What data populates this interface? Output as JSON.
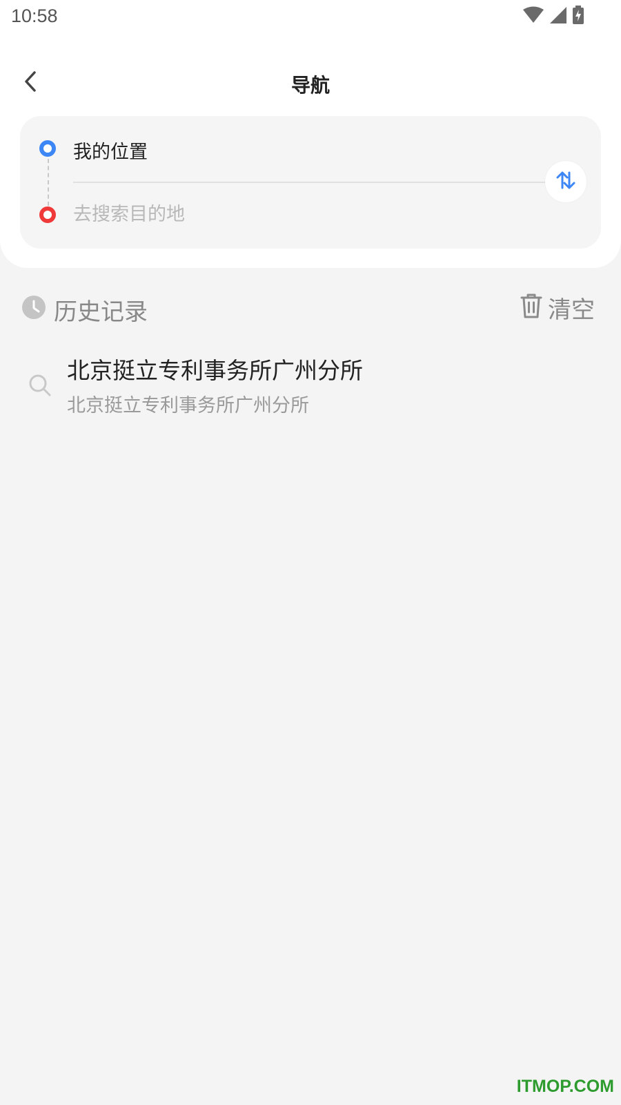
{
  "status_bar": {
    "time": "10:58",
    "icons": [
      "wifi-icon",
      "signal-icon",
      "battery-charging-icon"
    ]
  },
  "header": {
    "back_icon": "chevron-left-icon",
    "title": "导航"
  },
  "route": {
    "origin_label": "我的位置",
    "destination_value": "",
    "destination_placeholder": "去搜索目的地",
    "origin_color": "#3d86f6",
    "destination_color": "#f03a3a",
    "swap_icon": "swap-vertical-icon",
    "accent_color": "#3d86f6"
  },
  "history": {
    "title": "历史记录",
    "title_icon": "clock-icon",
    "clear_label": "清空",
    "clear_icon": "trash-icon",
    "items": [
      {
        "icon": "search-icon",
        "title": "北京挺立专利事务所广州分所",
        "subtitle": "北京挺立专利事务所广州分所"
      }
    ]
  },
  "watermark": "ITMOP.COM"
}
